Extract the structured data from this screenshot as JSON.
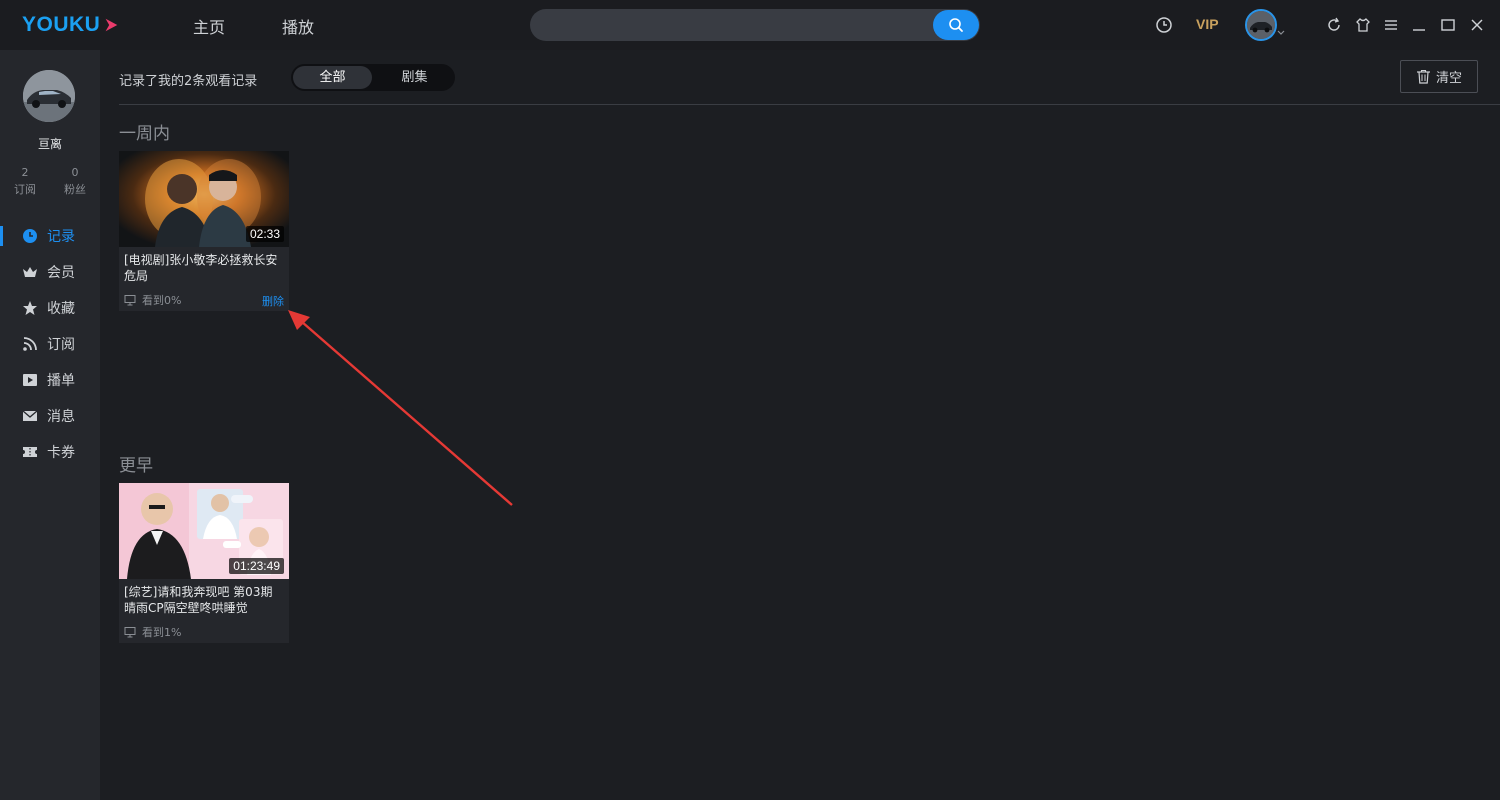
{
  "app": {
    "logo_text": "YOUKU",
    "nav": {
      "home": "主页",
      "play": "播放"
    },
    "search": {
      "value": "",
      "placeholder": ""
    },
    "vip_label": "VIP",
    "icons": [
      "history-clock-icon",
      "vip-label",
      "user-avatar",
      "refresh-icon",
      "skin-icon",
      "menu-icon",
      "minimize-icon",
      "maximize-icon",
      "close-icon"
    ],
    "accent": "#1d8ff1",
    "brand_color": "#1ba0f2"
  },
  "sidebar": {
    "username": "亘离",
    "stats": [
      {
        "count": "2",
        "label": "订阅"
      },
      {
        "count": "0",
        "label": "粉丝"
      }
    ],
    "items": [
      {
        "label": "记录",
        "icon": "clock-icon",
        "active": true
      },
      {
        "label": "会员",
        "icon": "crown-icon"
      },
      {
        "label": "收藏",
        "icon": "star-icon"
      },
      {
        "label": "订阅",
        "icon": "rss-icon"
      },
      {
        "label": "播单",
        "icon": "playlist-icon"
      },
      {
        "label": "消息",
        "icon": "mail-icon"
      },
      {
        "label": "卡券",
        "icon": "ticket-icon"
      }
    ]
  },
  "main": {
    "summary": "记录了我的2条观看记录",
    "filter": {
      "all": "全部",
      "series": "剧集",
      "selected": "全部"
    },
    "clear_label": "清空",
    "sections": [
      {
        "title": "一周内",
        "items": [
          {
            "title": "[电视剧]张小敬李必拯救长安危局",
            "duration": "02:33",
            "progress": "看到0%",
            "delete_label": "删除"
          }
        ]
      },
      {
        "title": "更早",
        "items": [
          {
            "title": "[综艺]请和我奔现吧 第03期 晴雨CP隔空壁咚哄睡觉",
            "duration": "01:23:49",
            "progress": "看到1%"
          }
        ]
      }
    ]
  }
}
